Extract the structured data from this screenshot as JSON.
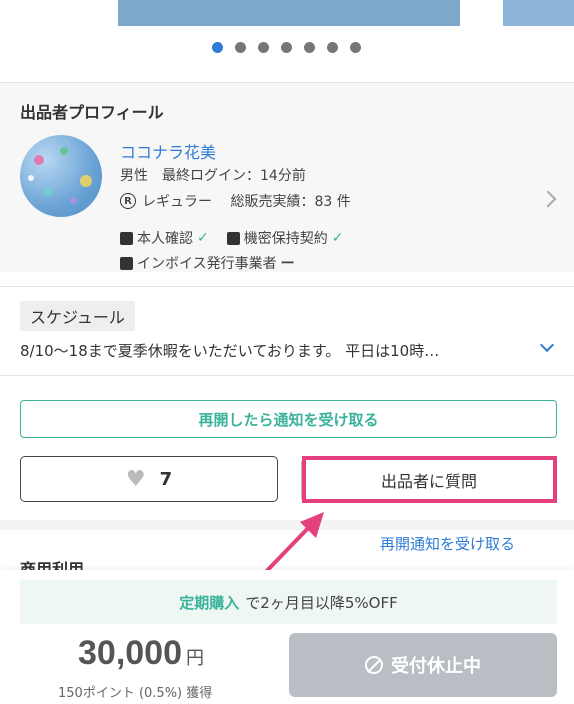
{
  "carousel": {
    "count": 7,
    "active": 0
  },
  "profile": {
    "title": "出品者プロフィール",
    "name": "ココナラ花美",
    "info1": "男性　最終ログイン：14分前",
    "rank_badge": "R",
    "info2": "レギュラー　 総販売実績：83 件",
    "verify1": "本人確認",
    "verify2": "機密保持契約",
    "invoice": "インボイス発行事業者",
    "invoice_status": "ー"
  },
  "schedule": {
    "tag": "スケジュール",
    "text": "8/10〜18まで夏季休暇をいただいております。 平日は10時…"
  },
  "buttons": {
    "notify": "再開したら通知を受け取る",
    "like_count": "7",
    "ask": "出品者に質問",
    "reopen_link": "再開通知を受け取る",
    "closed": "受付休止中"
  },
  "partial_heading": "商用利用",
  "promo": {
    "highlight": "定期購入",
    "text": "で2ヶ月目以降5%OFF"
  },
  "price": {
    "amount": "30,000",
    "unit": "円",
    "points": "150ポイント (0.5%) 獲得"
  },
  "colors": {
    "accent_green": "#3bb39b",
    "link_blue": "#2f7cd6",
    "highlight_pink": "#e5407e"
  }
}
